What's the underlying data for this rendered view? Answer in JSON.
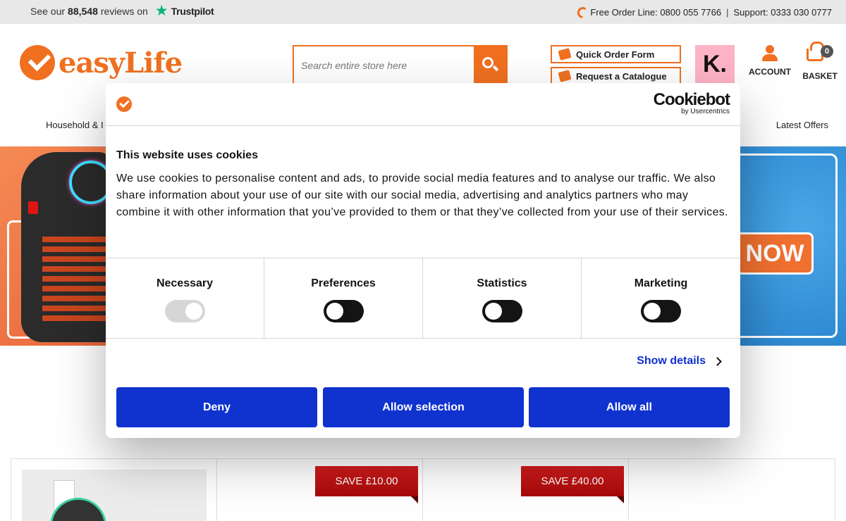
{
  "topbar": {
    "reviews_prefix": "See our",
    "reviews_count": "88,548",
    "reviews_suffix": "reviews on",
    "trustpilot": "Trustpilot",
    "order_line": "Free Order Line: 0800 055 7766",
    "separator": "|",
    "support": "Support: 0333 030 0777"
  },
  "header": {
    "logo_text": "easyLife",
    "search_placeholder": "Search entire store here",
    "quick_order": "Quick Order Form",
    "catalogue": "Request a Catalogue",
    "klarna": "K.",
    "account": "ACCOUNT",
    "basket": "BASKET",
    "basket_count": "0"
  },
  "nav": {
    "left_item": "Household & I",
    "right_item": "Latest Offers"
  },
  "banner": {
    "cta": "NOW"
  },
  "products": [
    {
      "badge": ""
    },
    {
      "badge": "SAVE £10.00"
    },
    {
      "badge": "SAVE £40.00"
    },
    {
      "badge": ""
    }
  ],
  "cookie": {
    "brand": "Cookiebot",
    "brand_sub": "by Usercentrics",
    "title": "This website uses cookies",
    "text": "We use cookies to personalise content and ads, to provide social media features and to analyse our traffic. We also share information about your use of our site with our social media, advertising and analytics partners who may combine it with other information that you’ve provided to them or that they’ve collected from your use of their services.",
    "categories": [
      {
        "label": "Necessary",
        "state": "on-disabled"
      },
      {
        "label": "Preferences",
        "state": "off"
      },
      {
        "label": "Statistics",
        "state": "off"
      },
      {
        "label": "Marketing",
        "state": "off"
      }
    ],
    "show_details": "Show details",
    "deny": "Deny",
    "allow_selection": "Allow selection",
    "allow_all": "Allow all"
  },
  "colors": {
    "brand_orange": "#f07020",
    "button_blue": "#1032cf",
    "save_red": "#c01010"
  }
}
